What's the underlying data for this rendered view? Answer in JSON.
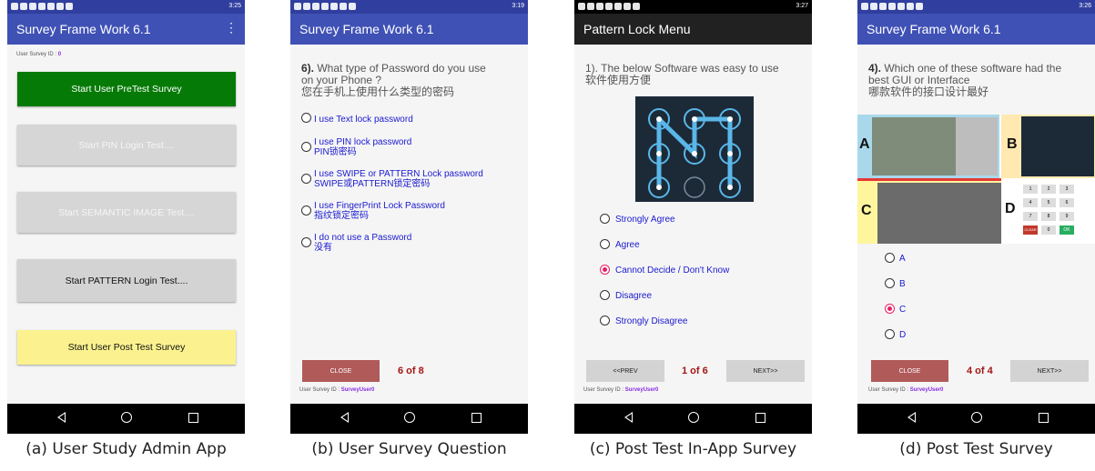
{
  "status_times": [
    "3:25",
    "3:19",
    "3:27",
    "3:26"
  ],
  "panel_a": {
    "title": "Survey Frame Work 6.1",
    "menu": "⋮",
    "uid_label": "User Survey ID :",
    "uid_value": "0",
    "buttons": [
      "Start User PreTest Survey",
      "Start PIN Login Test....",
      "Start SEMANTIC IMAGE Test....",
      "Start PATTERN Login Test....",
      "Start User Post Test Survey"
    ],
    "caption": "(a) User Study Admin App"
  },
  "panel_b": {
    "title": "Survey Frame Work 6.1",
    "qnum": "6).",
    "q_line1": "What type of Password do you use",
    "q_line2": "on your Phone ?",
    "q_line3": "您在手机上使用什么类型的密码",
    "options": [
      {
        "l1": "I use Text lock password",
        "l2": ""
      },
      {
        "l1": "I use PIN lock password",
        "l2": "PIN锁密码"
      },
      {
        "l1": "I use SWIPE or PATTERN Lock password",
        "l2": "SWIPE或PATTERN锁定密码"
      },
      {
        "l1": "I use FingerPrint Lock Password",
        "l2": "指纹锁定密码"
      },
      {
        "l1": "I do not use a Password",
        "l2": "没有"
      }
    ],
    "close": "CLOSE",
    "page": "6 of 8",
    "sid_label": "User Survey ID :",
    "sid_value": "SurveyUser0",
    "caption": "(b) User Survey Question"
  },
  "panel_c": {
    "title": "Pattern Lock Menu",
    "q_line1": "1). The below Software was easy to use",
    "q_line2": "软件使用方便",
    "options": [
      "Strongly Agree",
      "Agree",
      "Cannot Decide / Don't Know",
      "Disagree",
      "Strongly Disagree"
    ],
    "selected_index": 2,
    "prev": "<<PREV",
    "page": "1 of 6",
    "next": "NEXT>>",
    "sid_label": "User Survey ID :",
    "sid_value": "SurveyUser0",
    "caption": "(c) Post Test In-App Survey"
  },
  "panel_d": {
    "title": "Survey Frame Work 6.1",
    "qnum": "4).",
    "q_line1": "Which one of these software had the",
    "q_line2": "best GUI or Interface",
    "q_line3": "哪款软件的接口设计最好",
    "grid_labels": [
      "A",
      "B",
      "C",
      "D"
    ],
    "keypad": [
      "1",
      "2",
      "3",
      "4",
      "5",
      "6",
      "7",
      "8",
      "9",
      "CLEAR",
      "0",
      "OK"
    ],
    "options": [
      "A",
      "B",
      "C",
      "D"
    ],
    "selected_index": 2,
    "close": "CLOSE",
    "page": "4 of 4",
    "next": "NEXT>>",
    "sid_label": "User Survey ID :",
    "sid_value": "SurveyUser0",
    "caption": "(d) Post Test Survey"
  }
}
